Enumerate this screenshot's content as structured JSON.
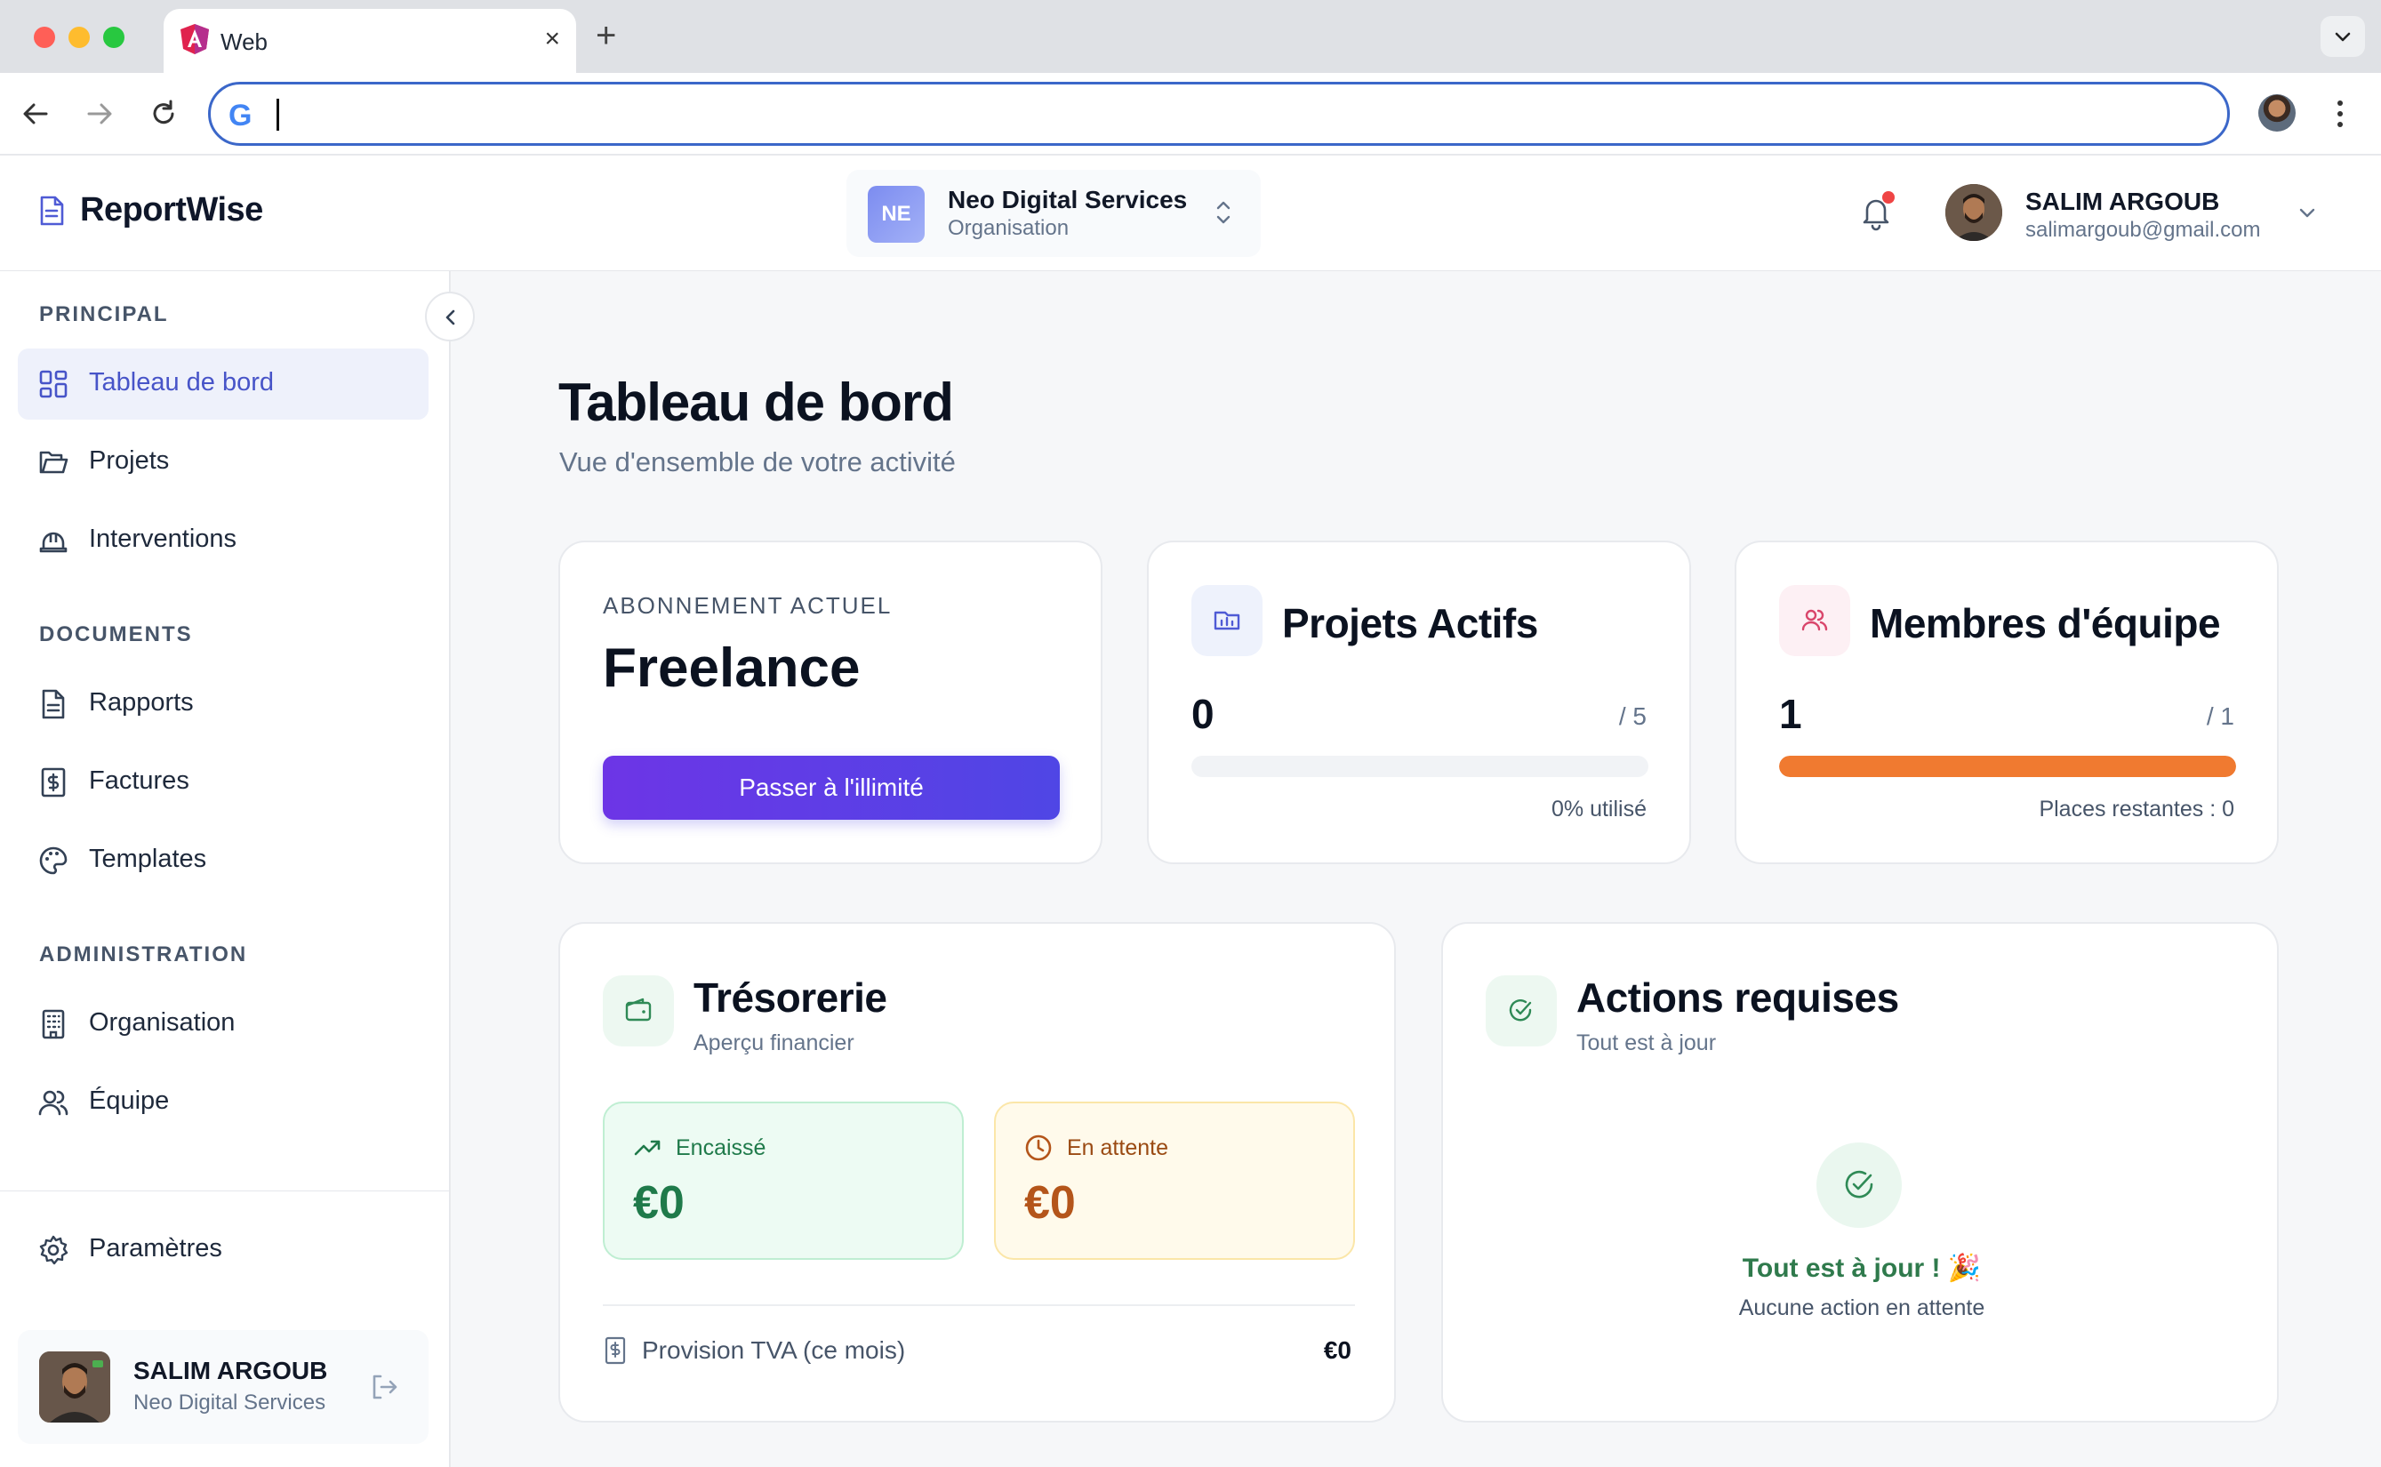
{
  "browser": {
    "tab_title": "Web",
    "tab_close": "×",
    "new_tab": "+",
    "address_value": "",
    "icons": [
      "angular-icon",
      "back-icon",
      "forward-icon",
      "reload-icon",
      "google-icon",
      "kebab-icon"
    ]
  },
  "header": {
    "brand": "ReportWise",
    "org_badge": "NE",
    "org_name": "Neo Digital Services",
    "org_type": "Organisation",
    "user_name": "SALIM ARGOUB",
    "user_email": "salimargoub@gmail.com"
  },
  "sidebar": {
    "sections": {
      "principal": "PRINCIPAL",
      "documents": "DOCUMENTS",
      "administration": "ADMINISTRATION"
    },
    "items": [
      {
        "label": "Tableau de bord",
        "icon": "dashboard-icon",
        "active": true
      },
      {
        "label": "Projets",
        "icon": "folder-icon"
      },
      {
        "label": "Interventions",
        "icon": "hard-hat-icon"
      },
      {
        "label": "Rapports",
        "icon": "file-icon"
      },
      {
        "label": "Factures",
        "icon": "invoice-icon"
      },
      {
        "label": "Templates",
        "icon": "palette-icon"
      },
      {
        "label": "Organisation",
        "icon": "building-icon"
      },
      {
        "label": "Équipe",
        "icon": "users-icon"
      },
      {
        "label": "Paramètres",
        "icon": "gear-icon"
      }
    ],
    "user": {
      "name": "SALIM ARGOUB",
      "org": "Neo Digital Services"
    }
  },
  "main": {
    "title": "Tableau de bord",
    "subtitle": "Vue d'ensemble de votre activité",
    "subscription": {
      "label": "ABONNEMENT ACTUEL",
      "plan": "Freelance",
      "button": "Passer à l'illimité"
    },
    "projects": {
      "title": "Projets Actifs",
      "value": "0",
      "limit": "/ 5",
      "usage_fraction": 0,
      "footer": "0% utilisé"
    },
    "team": {
      "title": "Membres d'équipe",
      "value": "1",
      "limit": "/ 1",
      "usage_fraction": 1,
      "footer": "Places restantes : 0"
    },
    "treasury": {
      "title": "Trésorerie",
      "subtitle": "Aperçu financier",
      "collected_label": "Encaissé",
      "collected_value": "€0",
      "pending_label": "En attente",
      "pending_value": "€0",
      "tva_label": "Provision TVA (ce mois)",
      "tva_value": "€0"
    },
    "actions": {
      "title": "Actions requises",
      "subtitle": "Tout est à jour",
      "empty_title": "Tout est à jour ! 🎉",
      "empty_sub": "Aucune action en attente"
    }
  },
  "colors": {
    "accent": "#4f46e5",
    "active_nav_bg": "#eef1fb",
    "team_bar": "#f07a30",
    "success": "#2f7a4c",
    "warning": "#b4551a"
  }
}
